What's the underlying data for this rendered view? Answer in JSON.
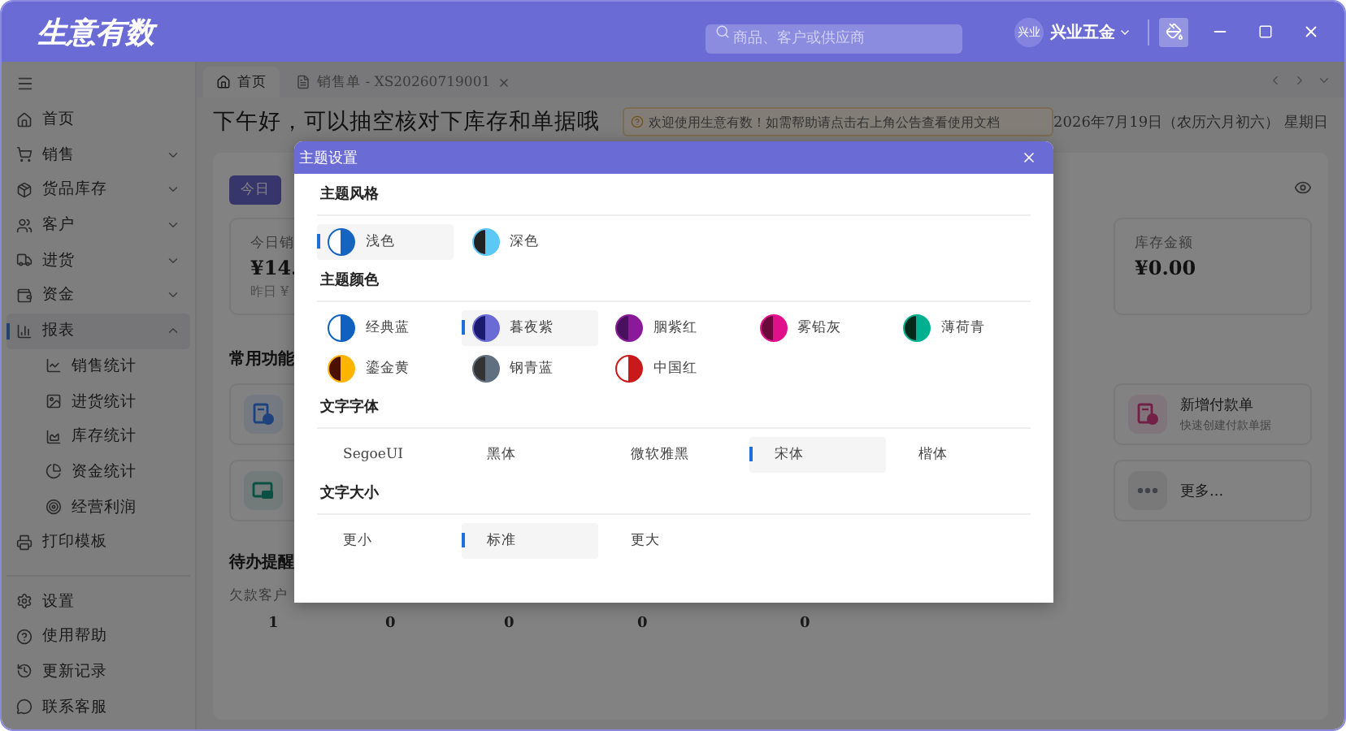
{
  "app_title": "生意有数",
  "search": {
    "placeholder": "商品、客户或供应商"
  },
  "company": {
    "avatar": "兴业",
    "name": "兴业五金"
  },
  "sidebar": {
    "items": [
      {
        "label": "首页"
      },
      {
        "label": "销售",
        "expanded": false
      },
      {
        "label": "货品库存",
        "expanded": false
      },
      {
        "label": "客户",
        "expanded": false
      },
      {
        "label": "进货",
        "expanded": false
      },
      {
        "label": "资金",
        "expanded": false
      },
      {
        "label": "报表",
        "expanded": true,
        "selected": true,
        "children": [
          {
            "label": "销售统计"
          },
          {
            "label": "进货统计"
          },
          {
            "label": "库存统计"
          },
          {
            "label": "资金统计"
          },
          {
            "label": "经营利润"
          }
        ]
      },
      {
        "label": "打印模板"
      }
    ],
    "footer": [
      {
        "label": "设置"
      },
      {
        "label": "使用帮助"
      },
      {
        "label": "更新记录"
      },
      {
        "label": "联系客服"
      }
    ]
  },
  "tabs": [
    {
      "label": "首页",
      "selected": true
    },
    {
      "label": "销售单 - XS20260719001",
      "selected": false,
      "closable": true
    }
  ],
  "greeting": "下午好，可以抽空核对下库存和单据哦",
  "notice": "欢迎使用生意有数！如需帮助请点击右上角公告查看使用文档",
  "date": "2026年7月19日（农历六月初六） 星期日",
  "period_tabs": [
    {
      "label": "今日",
      "selected": true
    }
  ],
  "stats": [
    {
      "label": "今日销",
      "value": "¥14.",
      "compare": "昨日 ¥"
    },
    {
      "label": "库存金额",
      "value": "¥0.00"
    }
  ],
  "shortcuts_title": "常用功能",
  "shortcuts": [
    {
      "kind": "document"
    },
    {
      "kind": "payment",
      "title": "新增付款单",
      "subtitle": "快速创建付款单据"
    },
    {
      "kind": "card"
    },
    {
      "kind": "more",
      "title": "更多..."
    }
  ],
  "todo": {
    "title": "待办提醒",
    "label": "欠款客户",
    "values": [
      "1",
      "0",
      "0",
      "0",
      "0"
    ]
  },
  "modal": {
    "title": "主题设置",
    "sections": [
      {
        "title": "主题风格",
        "kind": "swatch",
        "options": [
          {
            "label": "浅色",
            "selected": true,
            "halves": [
              {
                "color": "#ffffff"
              },
              {
                "color": "#1565c0"
              }
            ]
          },
          {
            "label": "深色",
            "selected": false,
            "halves": [
              {
                "color": "#222222"
              },
              {
                "color": "#5bc8f5"
              }
            ]
          }
        ]
      },
      {
        "title": "主题颜色",
        "kind": "swatch",
        "options": [
          {
            "label": "经典蓝",
            "selected": false,
            "halves": [
              {
                "color": "#ffffff"
              },
              {
                "color": "#1060c0"
              }
            ]
          },
          {
            "label": "暮夜紫",
            "selected": true,
            "halves": [
              {
                "color": "#1a1a6e"
              },
              {
                "color": "#6b6bd6"
              }
            ]
          },
          {
            "label": "胭紫红",
            "selected": false,
            "halves": [
              {
                "color": "#4a1060"
              },
              {
                "color": "#8a1a9a"
              }
            ]
          },
          {
            "label": "雾铅灰",
            "selected": false,
            "halves": [
              {
                "color": "#6a0a3a"
              },
              {
                "color": "#e0108a"
              }
            ]
          },
          {
            "label": "薄荷青",
            "selected": false,
            "halves": [
              {
                "color": "#002a1a"
              },
              {
                "color": "#00b090"
              }
            ]
          },
          {
            "label": "鎏金黄",
            "selected": false,
            "halves": [
              {
                "color": "#4a1000"
              },
              {
                "color": "#ffb400"
              }
            ]
          },
          {
            "label": "钢青蓝",
            "selected": false,
            "halves": [
              {
                "color": "#333333"
              },
              {
                "color": "#607080"
              }
            ]
          },
          {
            "label": "中国红",
            "selected": false,
            "halves": [
              {
                "color": "#ffffff"
              },
              {
                "color": "#c81a1a"
              }
            ]
          }
        ]
      },
      {
        "title": "文字字体",
        "kind": "text",
        "options": [
          {
            "label": "SegoeUI",
            "selected": false
          },
          {
            "label": "黑体",
            "selected": false
          },
          {
            "label": "微软雅黑",
            "selected": false
          },
          {
            "label": "宋体",
            "selected": true
          },
          {
            "label": "楷体",
            "selected": false
          }
        ]
      },
      {
        "title": "文字大小",
        "kind": "text",
        "options": [
          {
            "label": "更小",
            "selected": false
          },
          {
            "label": "标准",
            "selected": true
          },
          {
            "label": "更大",
            "selected": false
          }
        ]
      }
    ]
  }
}
